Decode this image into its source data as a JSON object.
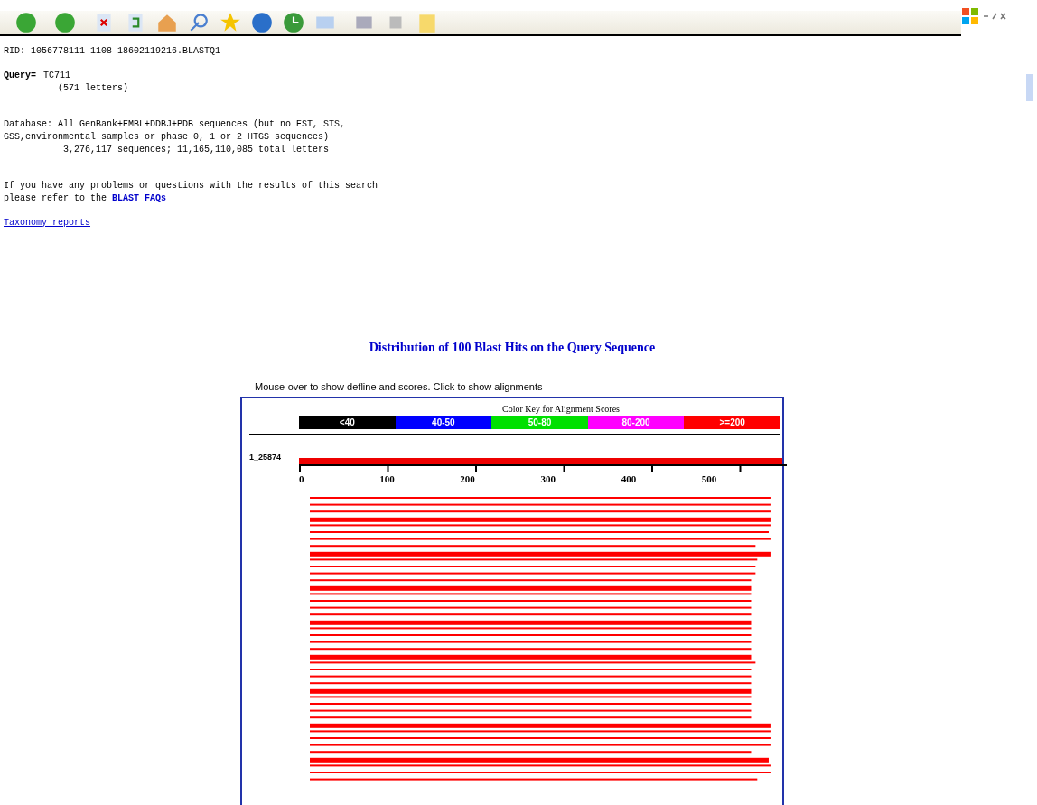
{
  "header_lines": [
    "RID: 1056778111-1108-18602119216.BLASTQ1"
  ],
  "query": {
    "label": "Query=",
    "name": "TC711",
    "length": "(571 letters)"
  },
  "database": [
    "Database: All GenBank+EMBL+DDBJ+PDB sequences (but no EST, STS,",
    "GSS,environmental samples or phase 0, 1 or 2 HTGS sequences)",
    "           3,276,117 sequences; 11,165,110,085 total letters"
  ],
  "help": {
    "text": "If you have any problems or questions with the results of this search",
    "text2": "please refer to the ",
    "link": "BLAST FAQs"
  },
  "taxonomy_link": "Taxonomy reports",
  "graphic": {
    "title": "Distribution of 100 Blast Hits on the Query Sequence",
    "hint": "Mouse-over to show defline and scores. Click to show alignments",
    "key_title": "Color Key for Alignment Scores",
    "key": [
      {
        "label": "<40",
        "color": "#000000"
      },
      {
        "label": "40-50",
        "color": "#0000ff"
      },
      {
        "label": "50-80",
        "color": "#00e000"
      },
      {
        "label": "80-200",
        "color": "#ff00ff"
      },
      {
        "label": ">=200",
        "color": "#ff0000"
      }
    ],
    "query_label": "1_25874",
    "axis_ticks": [
      "0",
      "100",
      "200",
      "300",
      "400",
      "500"
    ]
  }
}
